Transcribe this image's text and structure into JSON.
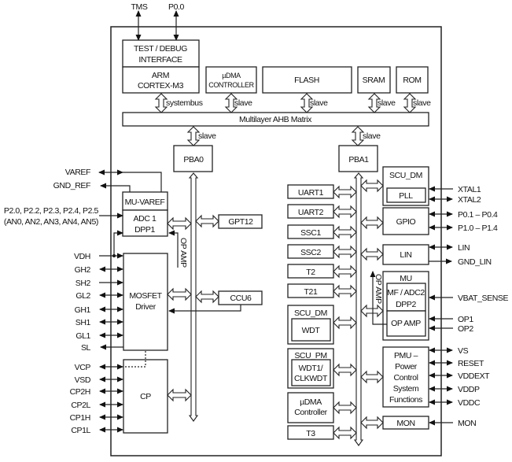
{
  "top_pins": {
    "tms": "TMS",
    "p00": "P0.0"
  },
  "core": {
    "test_debug": [
      "TEST / DEBUG",
      "INTERFACE"
    ],
    "arm": [
      "ARM",
      "CORTEX-M3"
    ],
    "udma": [
      "µDMA",
      "CONTROLLER"
    ],
    "flash": "FLASH",
    "sram": "SRAM",
    "rom": "ROM",
    "systembus": "systembus",
    "slave": "slave",
    "ahb": "Multilayer AHB Matrix",
    "pba0": "PBA0",
    "pba1": "PBA1"
  },
  "left_blocks": {
    "mu_varef": "MU-VAREF",
    "adc1": [
      "ADC 1",
      "DPP1"
    ],
    "gpt12": "GPT12",
    "op_amp": "OP AMP",
    "mosfet": [
      "MOSFET",
      "Driver"
    ],
    "ccu6": "CCU6",
    "cp": "CP"
  },
  "left_pins": {
    "varef": "VAREF",
    "gnd_ref": "GND_REF",
    "p2": [
      "P2.0, P2.2, P2.3, P2.4, P2.5",
      "(AN0, AN2, AN3, AN4, AN5)"
    ],
    "driver_pins": [
      "VDH",
      "GH2",
      "SH2",
      "GL2",
      "GH1",
      "SH1",
      "GL1",
      "SL"
    ],
    "cp_pins": [
      "VCP",
      "VSD",
      "CP2H",
      "CP2L",
      "CP1H",
      "CP1L"
    ]
  },
  "right_list": [
    "UART1",
    "UART2",
    "SSC1",
    "SSC2",
    "T2",
    "T21"
  ],
  "right_groups": {
    "scu_dm_wdt": [
      "SCU_DM",
      "WDT"
    ],
    "scu_pm": [
      "SCU_PM",
      "WDT1/",
      "CLKWDT"
    ],
    "udma_ctrl": [
      "µDMA",
      "Controller"
    ],
    "t3": "T3"
  },
  "right_blocks": {
    "scu_dm": "SCU_DM",
    "pll": "PLL",
    "gpio": "GPIO",
    "lin": "LIN",
    "mu": "MU",
    "mf_adc2": [
      "MF / ADC2",
      "DPP2"
    ],
    "op_amp_inner": "OP AMP",
    "op_amp_vertical": "OP AMP",
    "pmu": [
      "PMU –",
      "Power",
      "Control",
      "System",
      "Functions"
    ],
    "mon": "MON"
  },
  "right_pins": [
    "XTAL1",
    "XTAL2",
    "P0.1 – P0.4",
    "P1.0 – P1.4",
    "LIN",
    "GND_LIN",
    "VBAT_SENSE",
    "OP1",
    "OP2",
    "VS",
    "RESET",
    "VDDEXT",
    "VDDP",
    "VDDC",
    "MON"
  ]
}
